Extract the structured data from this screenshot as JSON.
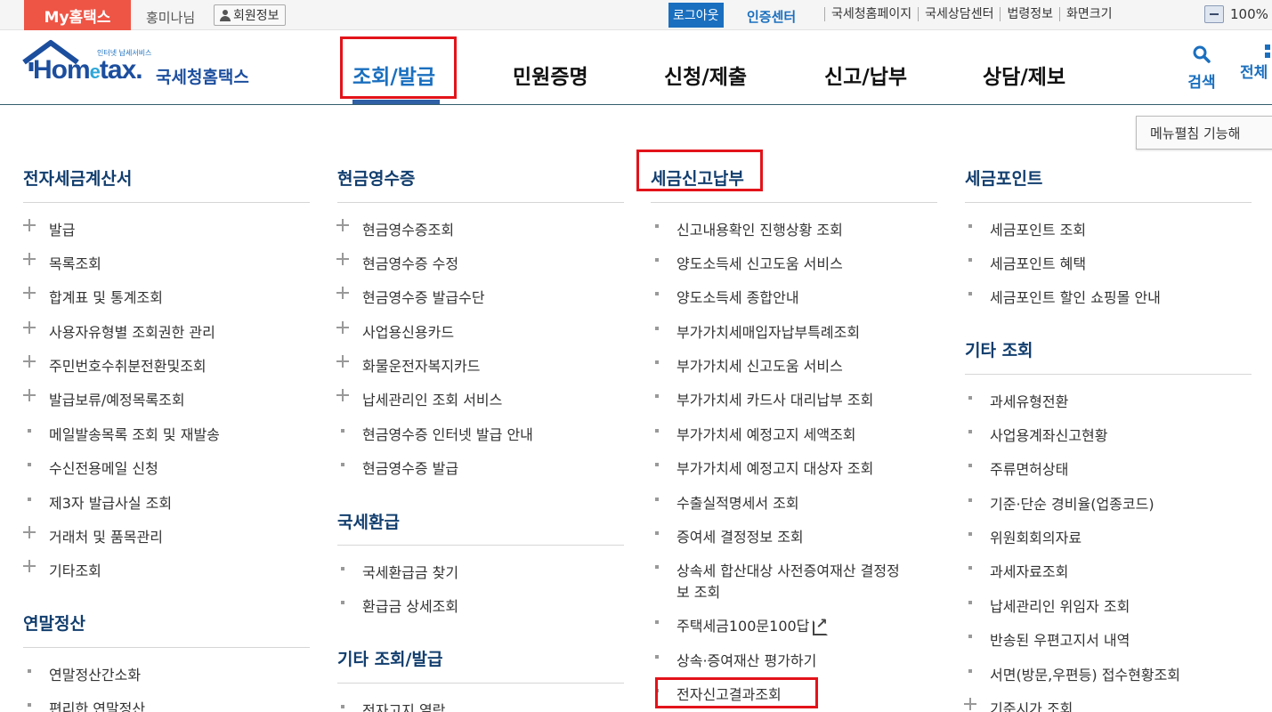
{
  "topbar": {
    "my_hometax": "My홈택스",
    "username": "홍미나님",
    "member_info": "회원정보",
    "logout": "로그아웃",
    "cert_center": "인증센터",
    "links": [
      "국세청홈페이지",
      "국세상담센터",
      "법령정보",
      "화면크기"
    ],
    "zoom": "100%"
  },
  "header": {
    "logo_sub": "인터넷 납세서비스",
    "logo_word_a": "Hom",
    "logo_word_e": "e",
    "logo_word_b": "tax.",
    "logo_kr": "국세청홈택스",
    "nav": [
      "조회/발급",
      "민원증명",
      "신청/제출",
      "신고/납부",
      "상담/제보"
    ],
    "search": "검색",
    "all": "전체"
  },
  "expand_button": "메뉴펼침 기능해",
  "col1": {
    "sec1_title": "전자세금계산서",
    "sec1_items": [
      "발급",
      "목록조회",
      "합계표 및 통계조회",
      "사용자유형별 조회권한 관리",
      "주민번호수취분전환및조회",
      "발급보류/예정목록조회",
      "메일발송목록 조회 및 재발송",
      "수신전용메일 신청",
      "제3자 발급사실 조회",
      "거래처 및 품목관리",
      "기타조회"
    ],
    "sec2_title": "연말정산",
    "sec2_items": [
      "연말정산간소화",
      "편리한 연말정산"
    ]
  },
  "col2": {
    "sec1_title": "현금영수증",
    "sec1_items": [
      "현금영수증조회",
      "현금영수증 수정",
      "현금영수증 발급수단",
      "사업용신용카드",
      "화물운전자복지카드",
      "납세관리인 조회 서비스",
      "현금영수증 인터넷 발급 안내",
      "현금영수증 발급"
    ],
    "sec2_title": "국세환급",
    "sec2_items": [
      "국세환급금 찾기",
      "환급금 상세조회"
    ],
    "sec3_title": "기타 조회/발급",
    "sec3_items": [
      "전자고지 열람"
    ]
  },
  "col3": {
    "sec1_title": "세금신고납부",
    "sec1_items": [
      "신고내용확인 진행상황 조회",
      "양도소득세 신고도움 서비스",
      "양도소득세 종합안내",
      "부가가치세매입자납부특례조회",
      "부가가치세 신고도움 서비스",
      "부가가치세 카드사 대리납부 조회",
      "부가가치세 예정고지 세액조회",
      "부가가치세 예정고지 대상자 조회",
      "수출실적명세서 조회",
      "증여세 결정정보 조회"
    ],
    "multiline_item_l1": "상속세 합산대상 사전증여재산 결정정",
    "multiline_item_l2": "보 조회",
    "faq_item": "주택세금100문100답",
    "eval_item": "상속·증여재산 평가하기",
    "result_item": "전자신고결과조회"
  },
  "col4": {
    "sec1_title": "세금포인트",
    "sec1_items": [
      "세금포인트 조회",
      "세금포인트 혜택",
      "세금포인트 할인 쇼핑몰 안내"
    ],
    "sec2_title": "기타 조회",
    "sec2_items": [
      "과세유형전환",
      "사업용계좌신고현황",
      "주류면허상태",
      "기준·단순 경비율(업종코드)",
      "위원회회의자료",
      "과세자료조회",
      "납세관리인 위임자 조회",
      "반송된 우편고지서 내역",
      "서면(방문,우편등) 접수현황조회",
      "기준시가 조회"
    ]
  },
  "colors": {
    "accent": "#1a6fbf",
    "highlight": "#e3131a",
    "brand": "#ee5545"
  }
}
